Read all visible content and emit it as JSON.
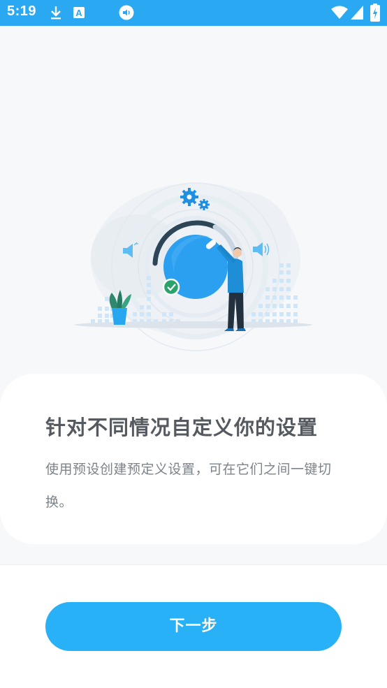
{
  "status_bar": {
    "time": "5:19",
    "icons": [
      "download-icon",
      "text-a-icon",
      "media-audio-icon",
      "wifi-icon",
      "signal-icon",
      "battery-charging-icon"
    ]
  },
  "hero": {
    "illustration": "volume-settings-illustration",
    "accent_color": "#2aa8f2"
  },
  "card": {
    "title": "针对不同情况自定义你的设置",
    "description": "使用预设创建预定义设置，可在它们之间一键切换。"
  },
  "footer": {
    "next_label": "下一步",
    "button_color": "#29b1f8"
  }
}
